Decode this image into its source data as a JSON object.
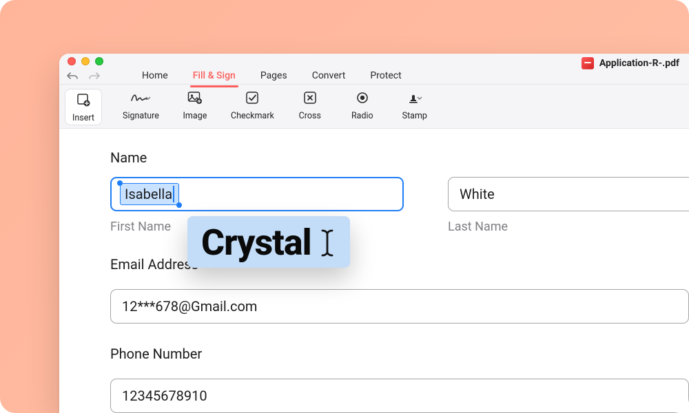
{
  "document": {
    "title": "Application-R-.pdf"
  },
  "tabs": {
    "home": "Home",
    "fill_sign": "Fill & Sign",
    "pages": "Pages",
    "convert": "Convert",
    "protect": "Protect",
    "active": "fill_sign"
  },
  "ribbon": {
    "insert": "Insert",
    "signature": "Signature",
    "image": "Image",
    "checkmark": "Checkmark",
    "cross": "Cross",
    "radio": "Radio",
    "stamp": "Stamp"
  },
  "form": {
    "name_label": "Name",
    "first_name_sub": "First Name",
    "last_name_sub": "Last Name",
    "first_name_value": "Isabella",
    "last_name_value": "White",
    "email_label": "Email  Address",
    "email_value": "12***678@Gmail.com",
    "phone_label": "Phone Number",
    "phone_value": "12345678910"
  },
  "overlay": {
    "typed_word": "Crystal"
  }
}
